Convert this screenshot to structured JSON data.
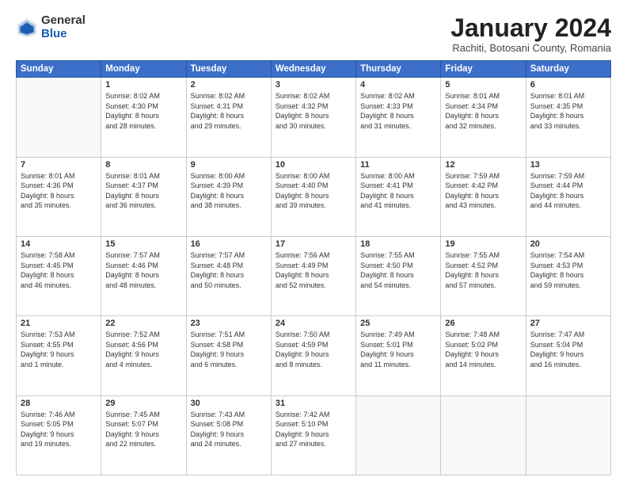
{
  "logo": {
    "general": "General",
    "blue": "Blue"
  },
  "title": "January 2024",
  "location": "Rachiti, Botosani County, Romania",
  "days_header": [
    "Sunday",
    "Monday",
    "Tuesday",
    "Wednesday",
    "Thursday",
    "Friday",
    "Saturday"
  ],
  "weeks": [
    [
      {
        "day": "",
        "info": ""
      },
      {
        "day": "1",
        "info": "Sunrise: 8:02 AM\nSunset: 4:30 PM\nDaylight: 8 hours\nand 28 minutes."
      },
      {
        "day": "2",
        "info": "Sunrise: 8:02 AM\nSunset: 4:31 PM\nDaylight: 8 hours\nand 29 minutes."
      },
      {
        "day": "3",
        "info": "Sunrise: 8:02 AM\nSunset: 4:32 PM\nDaylight: 8 hours\nand 30 minutes."
      },
      {
        "day": "4",
        "info": "Sunrise: 8:02 AM\nSunset: 4:33 PM\nDaylight: 8 hours\nand 31 minutes."
      },
      {
        "day": "5",
        "info": "Sunrise: 8:01 AM\nSunset: 4:34 PM\nDaylight: 8 hours\nand 32 minutes."
      },
      {
        "day": "6",
        "info": "Sunrise: 8:01 AM\nSunset: 4:35 PM\nDaylight: 8 hours\nand 33 minutes."
      }
    ],
    [
      {
        "day": "7",
        "info": "Sunrise: 8:01 AM\nSunset: 4:36 PM\nDaylight: 8 hours\nand 35 minutes."
      },
      {
        "day": "8",
        "info": "Sunrise: 8:01 AM\nSunset: 4:37 PM\nDaylight: 8 hours\nand 36 minutes."
      },
      {
        "day": "9",
        "info": "Sunrise: 8:00 AM\nSunset: 4:39 PM\nDaylight: 8 hours\nand 38 minutes."
      },
      {
        "day": "10",
        "info": "Sunrise: 8:00 AM\nSunset: 4:40 PM\nDaylight: 8 hours\nand 39 minutes."
      },
      {
        "day": "11",
        "info": "Sunrise: 8:00 AM\nSunset: 4:41 PM\nDaylight: 8 hours\nand 41 minutes."
      },
      {
        "day": "12",
        "info": "Sunrise: 7:59 AM\nSunset: 4:42 PM\nDaylight: 8 hours\nand 43 minutes."
      },
      {
        "day": "13",
        "info": "Sunrise: 7:59 AM\nSunset: 4:44 PM\nDaylight: 8 hours\nand 44 minutes."
      }
    ],
    [
      {
        "day": "14",
        "info": "Sunrise: 7:58 AM\nSunset: 4:45 PM\nDaylight: 8 hours\nand 46 minutes."
      },
      {
        "day": "15",
        "info": "Sunrise: 7:57 AM\nSunset: 4:46 PM\nDaylight: 8 hours\nand 48 minutes."
      },
      {
        "day": "16",
        "info": "Sunrise: 7:57 AM\nSunset: 4:48 PM\nDaylight: 8 hours\nand 50 minutes."
      },
      {
        "day": "17",
        "info": "Sunrise: 7:56 AM\nSunset: 4:49 PM\nDaylight: 8 hours\nand 52 minutes."
      },
      {
        "day": "18",
        "info": "Sunrise: 7:55 AM\nSunset: 4:50 PM\nDaylight: 8 hours\nand 54 minutes."
      },
      {
        "day": "19",
        "info": "Sunrise: 7:55 AM\nSunset: 4:52 PM\nDaylight: 8 hours\nand 57 minutes."
      },
      {
        "day": "20",
        "info": "Sunrise: 7:54 AM\nSunset: 4:53 PM\nDaylight: 8 hours\nand 59 minutes."
      }
    ],
    [
      {
        "day": "21",
        "info": "Sunrise: 7:53 AM\nSunset: 4:55 PM\nDaylight: 9 hours\nand 1 minute."
      },
      {
        "day": "22",
        "info": "Sunrise: 7:52 AM\nSunset: 4:56 PM\nDaylight: 9 hours\nand 4 minutes."
      },
      {
        "day": "23",
        "info": "Sunrise: 7:51 AM\nSunset: 4:58 PM\nDaylight: 9 hours\nand 6 minutes."
      },
      {
        "day": "24",
        "info": "Sunrise: 7:50 AM\nSunset: 4:59 PM\nDaylight: 9 hours\nand 8 minutes."
      },
      {
        "day": "25",
        "info": "Sunrise: 7:49 AM\nSunset: 5:01 PM\nDaylight: 9 hours\nand 11 minutes."
      },
      {
        "day": "26",
        "info": "Sunrise: 7:48 AM\nSunset: 5:02 PM\nDaylight: 9 hours\nand 14 minutes."
      },
      {
        "day": "27",
        "info": "Sunrise: 7:47 AM\nSunset: 5:04 PM\nDaylight: 9 hours\nand 16 minutes."
      }
    ],
    [
      {
        "day": "28",
        "info": "Sunrise: 7:46 AM\nSunset: 5:05 PM\nDaylight: 9 hours\nand 19 minutes."
      },
      {
        "day": "29",
        "info": "Sunrise: 7:45 AM\nSunset: 5:07 PM\nDaylight: 9 hours\nand 22 minutes."
      },
      {
        "day": "30",
        "info": "Sunrise: 7:43 AM\nSunset: 5:08 PM\nDaylight: 9 hours\nand 24 minutes."
      },
      {
        "day": "31",
        "info": "Sunrise: 7:42 AM\nSunset: 5:10 PM\nDaylight: 9 hours\nand 27 minutes."
      },
      {
        "day": "",
        "info": ""
      },
      {
        "day": "",
        "info": ""
      },
      {
        "day": "",
        "info": ""
      }
    ]
  ]
}
